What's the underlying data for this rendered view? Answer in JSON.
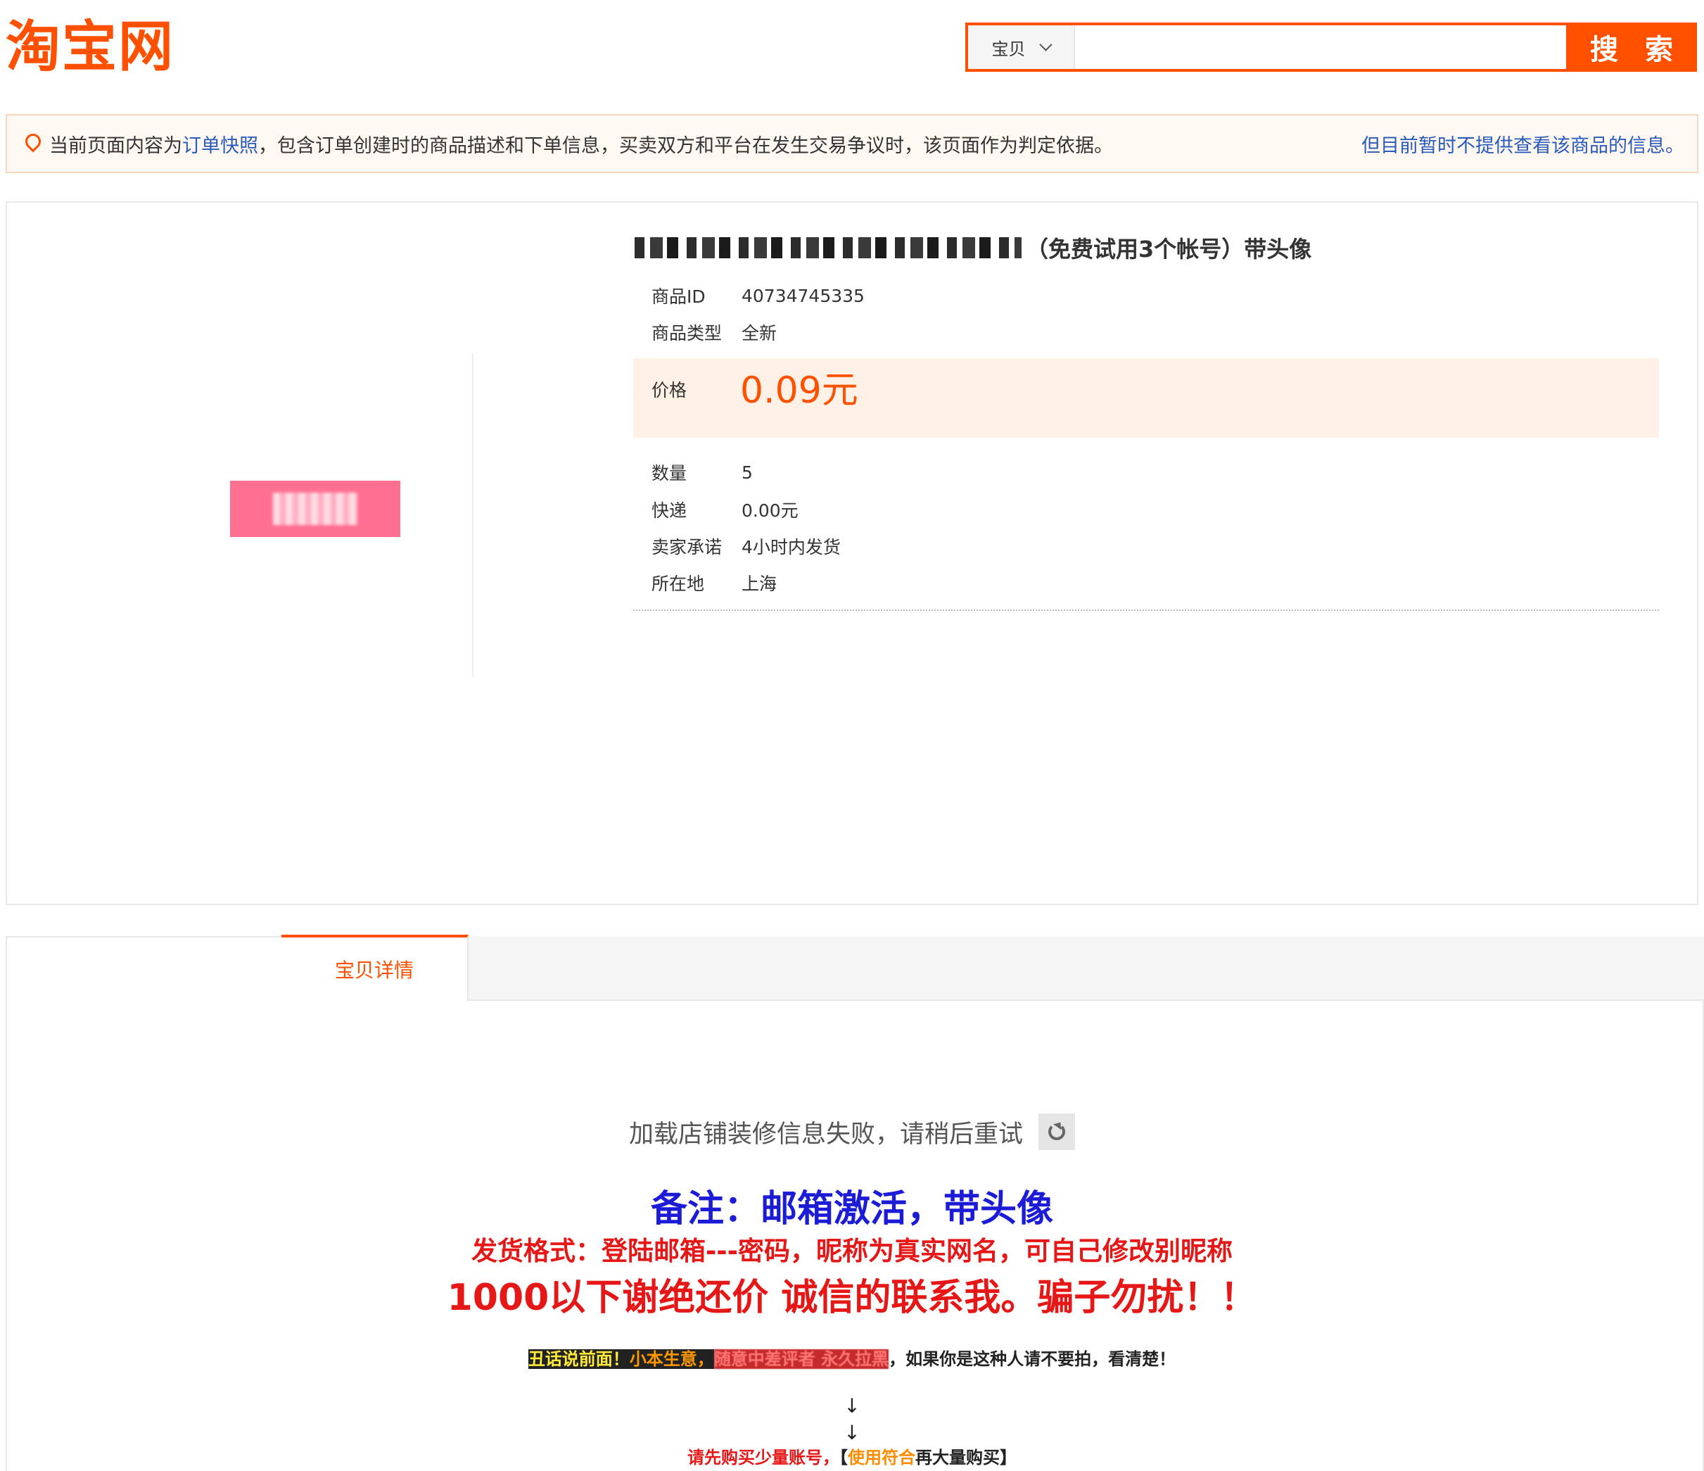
{
  "header": {
    "logo_text": "淘宝网",
    "search_type": "宝贝",
    "search_value": "",
    "search_button": "搜 索"
  },
  "notice": {
    "prefix": "当前页面内容为",
    "link": "订单快照",
    "body": "，包含订单创建时的商品描述和下单信息，买卖双方和平台在发生交易争议时，该页面作为判定依据。",
    "right": "但目前暂时不提供查看该商品的信息。"
  },
  "product": {
    "title_suffix": "（免费试用3个帐号）带头像",
    "fields": [
      {
        "label": "商品ID",
        "value": "40734745335"
      },
      {
        "label": "商品类型",
        "value": "全新"
      }
    ],
    "price_label": "价格",
    "price": "0.09元",
    "details": [
      {
        "label": "数量",
        "value": "5"
      },
      {
        "label": "快递",
        "value": "0.00元"
      },
      {
        "label": "卖家承诺",
        "value": "4小时内发货"
      },
      {
        "label": "所在地",
        "value": "上海"
      }
    ]
  },
  "tabs": {
    "active": "宝贝详情"
  },
  "detail": {
    "load_fail": "加载店铺装修信息失败，请稍后重试",
    "line1": "备注：邮箱激活，带头像",
    "line2": "发货格式：登陆邮箱---密码，昵称为真实网名，可自己修改别昵称",
    "line3": "1000以下谢绝还价 诚信的联系我。骗子勿扰！！",
    "line4_a": "丑话说前面！",
    "line4_b": "小本生意，",
    "line4_c": "随意中差评者 永久拉黑",
    "line4_d": "，如果你是这种人请不要拍，看清楚！",
    "arrow": "↓",
    "line5_a": "请先购买少量账号，",
    "line5_b": "【",
    "line5_c": "使用符合",
    "line5_d": "再大量购买】"
  },
  "colors": {
    "brand": "#ff5000",
    "link": "#2a5bb9",
    "note_blue": "#1c1cd6",
    "warn_red": "#e51717"
  }
}
